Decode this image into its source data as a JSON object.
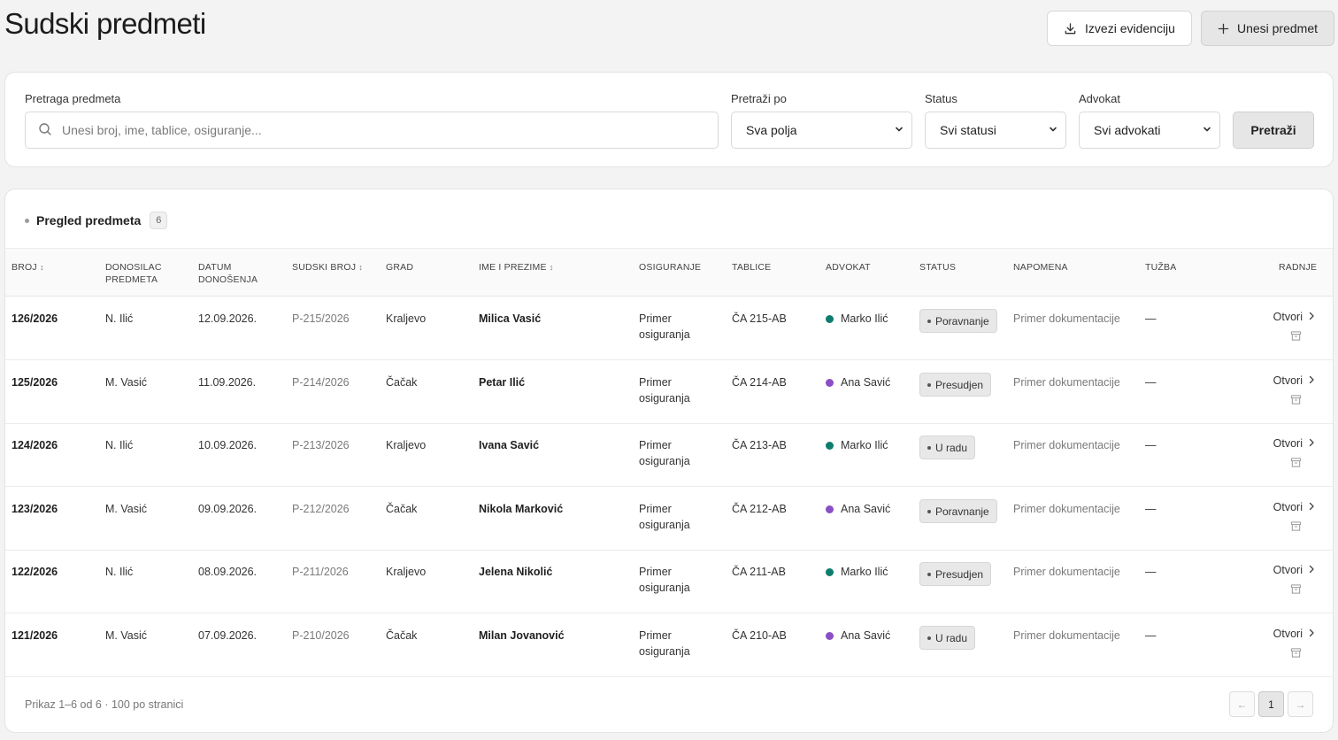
{
  "page": {
    "title": "Sudski predmeti"
  },
  "header": {
    "export_label": "Izvezi evidenciju",
    "add_label": "Unesi predmet"
  },
  "filters": {
    "search_label": "Pretraga predmeta",
    "search_placeholder": "Unesi broj, ime, tablice, osiguranje...",
    "search_by_label": "Pretraži po",
    "search_by_value": "Sva polja",
    "status_label": "Status",
    "status_value": "Svi statusi",
    "lawyer_label": "Advokat",
    "lawyer_value": "Svi advokati",
    "search_button": "Pretraži"
  },
  "table": {
    "section_title": "Pregled predmeta",
    "count": "6",
    "columns": {
      "broj": "BROJ",
      "donosilac_1": "DONOSILAC",
      "donosilac_2": "PREDMETA",
      "datum_1": "DATUM",
      "datum_2": "DONOŠENJA",
      "sudski_broj": "SUDSKI BROJ",
      "grad": "GRAD",
      "ime": "IME I PREZIME",
      "osiguranje": "OSIGURANJE",
      "tablice": "TABLICE",
      "advokat": "ADVOKAT",
      "status": "STATUS",
      "napomena": "NAPOMENA",
      "tuzba": "TUŽBA",
      "radnje": "RADNJE"
    },
    "sort_icon": "↕",
    "open_label": "Otvori",
    "rows": [
      {
        "broj": "126/2026",
        "donosilac": "N. Ilić",
        "datum": "12.09.2026.",
        "sudski_broj": "P-215/2026",
        "grad": "Kraljevo",
        "ime": "Milica Vasić",
        "osiguranje_1": "Primer",
        "osiguranje_2": "osiguranja",
        "tablice": "ČA 215-AB",
        "advokat": "Marko Ilić",
        "advokat_color": "#0f7d6e",
        "status": "Poravnanje",
        "napomena": "Primer dokumentacije",
        "tuzba": "—"
      },
      {
        "broj": "125/2026",
        "donosilac": "M. Vasić",
        "datum": "11.09.2026.",
        "sudski_broj": "P-214/2026",
        "grad": "Čačak",
        "ime": "Petar Ilić",
        "osiguranje_1": "Primer",
        "osiguranje_2": "osiguranja",
        "tablice": "ČA 214-AB",
        "advokat": "Ana Savić",
        "advokat_color": "#8b4fc4",
        "status": "Presudjen",
        "napomena": "Primer dokumentacije",
        "tuzba": "—"
      },
      {
        "broj": "124/2026",
        "donosilac": "N. Ilić",
        "datum": "10.09.2026.",
        "sudski_broj": "P-213/2026",
        "grad": "Kraljevo",
        "ime": "Ivana Savić",
        "osiguranje_1": "Primer",
        "osiguranje_2": "osiguranja",
        "tablice": "ČA 213-AB",
        "advokat": "Marko Ilić",
        "advokat_color": "#0f7d6e",
        "status": "U radu",
        "napomena": "Primer dokumentacije",
        "tuzba": "—"
      },
      {
        "broj": "123/2026",
        "donosilac": "M. Vasić",
        "datum": "09.09.2026.",
        "sudski_broj": "P-212/2026",
        "grad": "Čačak",
        "ime": "Nikola Marković",
        "osiguranje_1": "Primer",
        "osiguranje_2": "osiguranja",
        "tablice": "ČA 212-AB",
        "advokat": "Ana Savić",
        "advokat_color": "#8b4fc4",
        "status": "Poravnanje",
        "napomena": "Primer dokumentacije",
        "tuzba": "—"
      },
      {
        "broj": "122/2026",
        "donosilac": "N. Ilić",
        "datum": "08.09.2026.",
        "sudski_broj": "P-211/2026",
        "grad": "Kraljevo",
        "ime": "Jelena Nikolić",
        "osiguranje_1": "Primer",
        "osiguranje_2": "osiguranja",
        "tablice": "ČA 211-AB",
        "advokat": "Marko Ilić",
        "advokat_color": "#0f7d6e",
        "status": "Presudjen",
        "napomena": "Primer dokumentacije",
        "tuzba": "—"
      },
      {
        "broj": "121/2026",
        "donosilac": "M. Vasić",
        "datum": "07.09.2026.",
        "sudski_broj": "P-210/2026",
        "grad": "Čačak",
        "ime": "Milan Jovanović",
        "osiguranje_1": "Primer",
        "osiguranje_2": "osiguranja",
        "tablice": "ČA 210-AB",
        "advokat": "Ana Savić",
        "advokat_color": "#8b4fc4",
        "status": "U radu",
        "napomena": "Primer dokumentacije",
        "tuzba": "—"
      }
    ]
  },
  "footer": {
    "summary": "Prikaz 1–6 od 6 · 100 po stranici",
    "prev": "←",
    "page": "1",
    "next": "→"
  }
}
